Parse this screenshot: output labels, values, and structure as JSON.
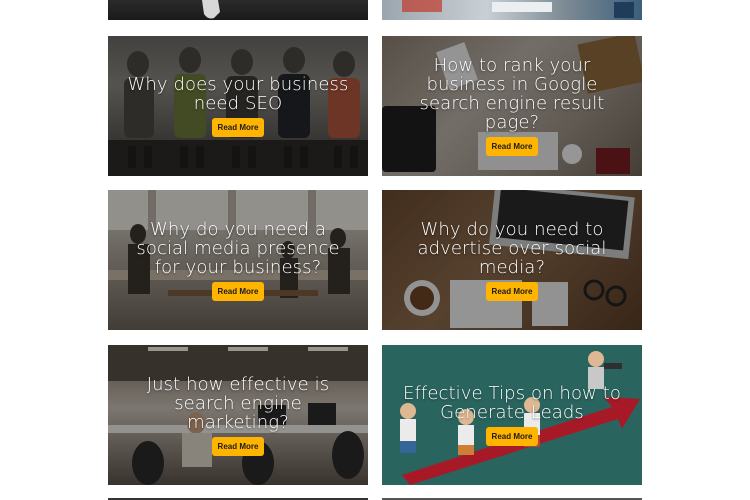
{
  "cards": [
    {
      "title": "Why does your business need SEO",
      "button": "Read More"
    },
    {
      "title": "How to rank your business in Google search engine result page?",
      "button": "Read More"
    },
    {
      "title": "Why do you need a social media presence for your business?",
      "button": "Read More"
    },
    {
      "title": "Why do you need to advertise over social media?",
      "button": "Read More"
    },
    {
      "title": "Just how effective is search engine marketing?",
      "button": "Read More"
    },
    {
      "title": "Effective Tips on how to Generate Leads",
      "button": "Read More"
    }
  ],
  "colors": {
    "button_bg": "#ffb400",
    "button_text": "#1b1b1b",
    "title_text": "#ffffff",
    "leads_card_bg": "#2e6d66",
    "arrow_red": "#b71c2b"
  }
}
